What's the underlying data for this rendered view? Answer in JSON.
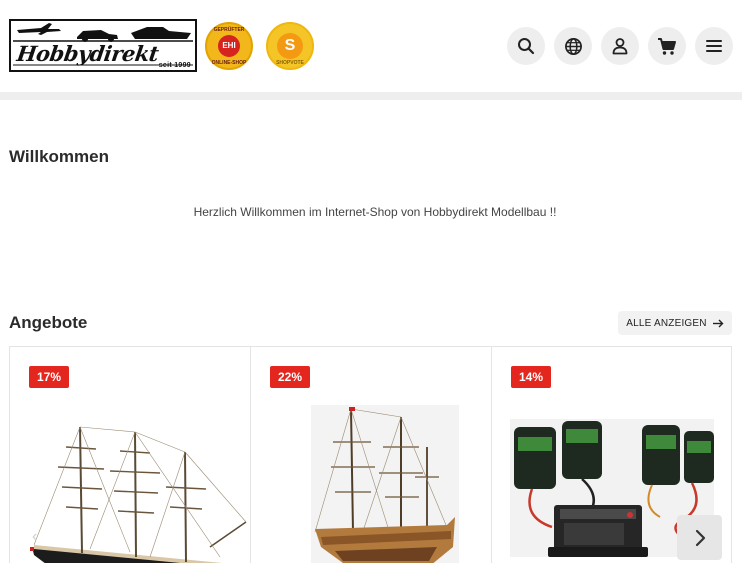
{
  "header": {
    "logo": {
      "brand": "Hobbydirekt",
      "since": "seit 1999"
    },
    "badges": {
      "ehi": {
        "top": "GEPRÜFTER",
        "center": "EHI",
        "bottom": "ONLINE-SHOP"
      },
      "shopvote": {
        "center": "S",
        "bottom": "SHOPVOTE"
      }
    },
    "icons": [
      "search-icon",
      "globe-icon",
      "user-icon",
      "cart-icon",
      "menu-icon"
    ]
  },
  "welcome": {
    "title": "Willkommen",
    "text": "Herzlich Willkommen im Internet-Shop von Hobbydirekt Modellbau !!"
  },
  "offers": {
    "title": "Angebote",
    "show_all": "ALLE ANZEIGEN",
    "products": [
      {
        "discount": "17%",
        "image": "clipper-ship-model"
      },
      {
        "discount": "22%",
        "image": "wooden-galleon-model"
      },
      {
        "discount": "14%",
        "image": "brushless-motor-esc-set"
      }
    ]
  },
  "colors": {
    "discount_badge": "#e3271f",
    "icon_button_bg": "#eeeeee",
    "text": "#2b2b2b"
  }
}
